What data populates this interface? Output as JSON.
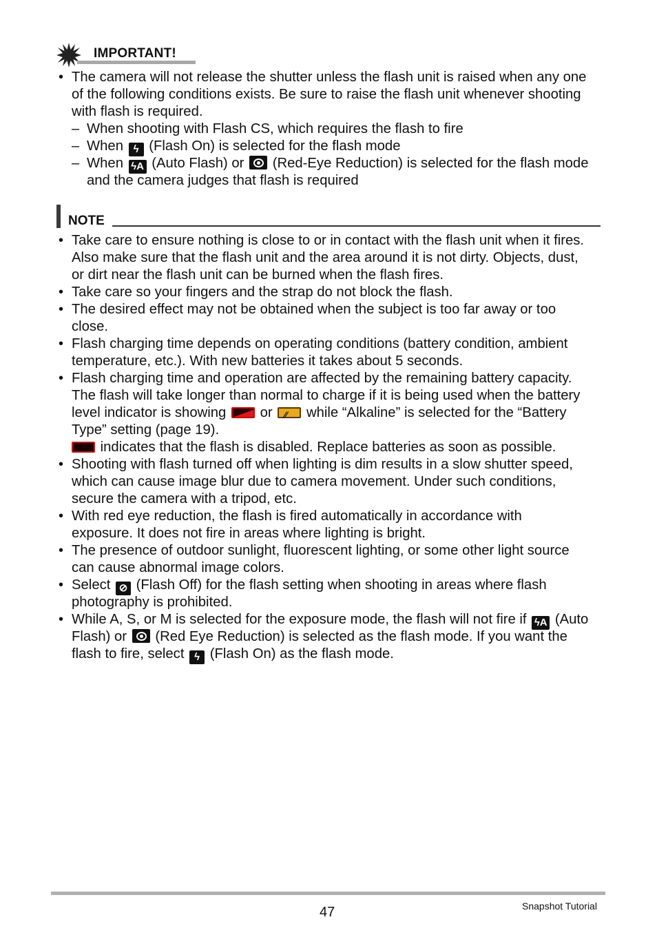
{
  "important": {
    "icon": "starburst-icon",
    "title": "IMPORTANT!",
    "bullet": {
      "lines": [
        "The camera will not release the shutter unless the flash unit is raised when any one",
        "of the following conditions exists. Be sure to raise the flash unit whenever shooting",
        "with flash is required."
      ],
      "subitems": [
        {
          "lines": [
            "When shooting with Flash CS, which requires the flash to fire"
          ]
        },
        {
          "pre": "When",
          "icon": "flash-on-icon",
          "post": "(Flash On) is selected for the flash mode"
        },
        {
          "pre": "When",
          "icon": "auto-flash-icon",
          "mid": "(Auto Flash) or",
          "icon2": "red-eye-reduction-icon",
          "post": "(Red-Eye Reduction) is selected for the flash mode",
          "line2": "and the camera judges that flash is required"
        }
      ]
    }
  },
  "note": {
    "title": "NOTE",
    "items": [
      {
        "lines": [
          "Take care to ensure nothing is close to or in contact with the flash unit when it fires.",
          "Also make sure that the flash unit and the area around it is not dirty. Objects, dust,",
          "or dirt near the flash unit can be burned when the flash fires."
        ]
      },
      {
        "lines": [
          "Take care so your fingers and the strap do not block the flash."
        ]
      },
      {
        "lines": [
          "The desired effect may not be obtained when the subject is too far away or too",
          "close."
        ]
      },
      {
        "lines": [
          "Flash charging time depends on operating conditions (battery condition, ambient",
          "temperature, etc.). With new batteries it takes about 5 seconds."
        ]
      },
      {
        "lines": [
          "Flash charging time and operation are affected by the remaining battery capacity.",
          "The flash will take longer than normal to charge if it is being used when the battery"
        ],
        "line3_pre": "level indicator is showing",
        "line3_mid": "or",
        "line3_post": "while “Alkaline” is selected for the “Battery",
        "line4": "Type” setting (page 19).",
        "line5": "indicates that the flash is disabled. Replace batteries as soon as possible."
      },
      {
        "lines": [
          "Shooting with flash turned off when lighting is dim results in a slow shutter speed,",
          "which can cause image blur due to camera movement. Under such conditions,",
          "secure the camera with a tripod, etc."
        ]
      },
      {
        "lines": [
          "With red eye reduction, the flash is fired automatically in accordance with",
          "exposure. It does not fire in areas where lighting is bright."
        ]
      },
      {
        "lines": [
          "The presence of outdoor sunlight, fluorescent lighting, or some other light source",
          "can cause abnormal image colors."
        ]
      },
      {
        "pre": "Select",
        "post": "(Flash Off) for the flash setting when shooting in areas where flash",
        "line2": "photography is prohibited."
      },
      {
        "pre": "While A, S, or M is selected for the exposure mode, the flash will not fire if",
        "post": "(Auto",
        "line2_pre": "Flash) or",
        "line2_post": "(Red Eye Reduction) is selected as the flash mode. If you want the",
        "line3_pre": "flash to fire, select",
        "line3_post": "(Flash On) as the flash mode."
      }
    ]
  },
  "icons": {
    "flash_on": "ϟ",
    "auto_flash": "ϟA",
    "flash_off": "⊘"
  },
  "footer": {
    "page_number": "47",
    "section": "Snapshot Tutorial"
  }
}
